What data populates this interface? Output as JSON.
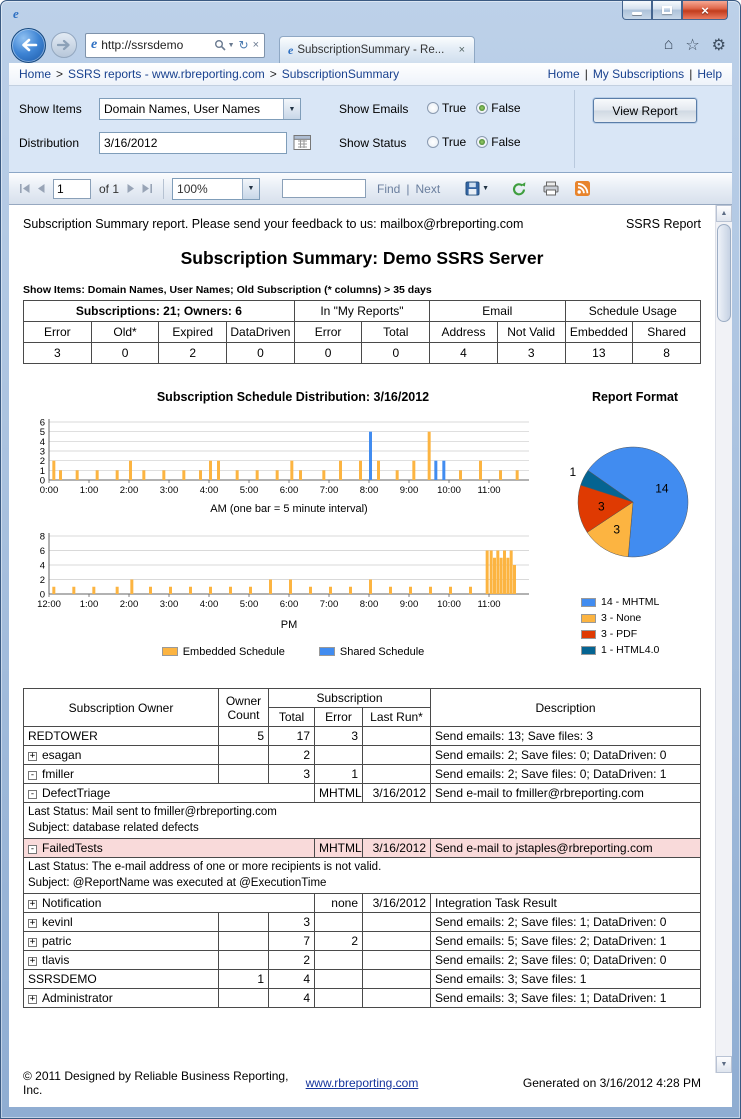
{
  "browser": {
    "url": "http://ssrsdemo",
    "tab_title": "SubscriptionSummary - Re...",
    "crumb_separator": ">",
    "link_separator": "|",
    "breadcrumbs": [
      "Home",
      "SSRS reports - www.rbreporting.com",
      "SubscriptionSummary"
    ],
    "top_links": [
      "Home",
      "My Subscriptions",
      "Help"
    ]
  },
  "icons": {
    "ie_logo": "e",
    "close": "×",
    "caret": "▼",
    "home": "⌂",
    "star": "☆",
    "gear": "⚙",
    "refresh": "↻",
    "up": "▲",
    "down": "▼",
    "pipe": "|"
  },
  "parameters": {
    "show_items_label": "Show Items",
    "show_items_value": "Domain Names, User Names",
    "show_emails_label": "Show Emails",
    "show_emails_value": "False",
    "distribution_label": "Distribution",
    "distribution_value": "3/16/2012",
    "show_status_label": "Show Status",
    "show_status_value": "False",
    "true_label": "True",
    "false_label": "False",
    "view_report_label": "View Report"
  },
  "viewer_toolbar": {
    "current_page": "1",
    "page_count_label": "of 1",
    "zoom_value": "100%",
    "find_value": "",
    "find_label": "Find",
    "next_label": "Next"
  },
  "report": {
    "feedback_line": "Subscription Summary report. Please send your feedback to us: mailbox@rbreporting.com",
    "corner_label": "SSRS Report",
    "title": "Subscription Summary: Demo SSRS Server",
    "filter_line": "Show Items: Domain Names, User Names; Old Subscription (* columns) > 35 days",
    "summary_table": {
      "groups": [
        {
          "label": "Subscriptions: 21; Owners: 6",
          "bold": true,
          "columns": [
            "Error",
            "Old*",
            "Expired",
            "DataDriven"
          ],
          "values": [
            "3",
            "0",
            "2",
            "0"
          ]
        },
        {
          "label": "In \"My Reports\"",
          "bold": false,
          "columns": [
            "Error",
            "Total"
          ],
          "values": [
            "0",
            "0"
          ]
        },
        {
          "label": "Email",
          "bold": false,
          "columns": [
            "Address",
            "Not Valid"
          ],
          "values": [
            "4",
            "3"
          ]
        },
        {
          "label": "Schedule Usage",
          "bold": false,
          "columns": [
            "Embedded",
            "Shared"
          ],
          "values": [
            "13",
            "8"
          ]
        }
      ]
    },
    "footer": {
      "copyright": "© 2011 Designed by Reliable Business Reporting, Inc.",
      "link": "www.rbreporting.com",
      "generated": "Generated on 3/16/2012 4:28 PM"
    }
  },
  "chart_data": [
    {
      "type": "bar",
      "title": "Subscription Schedule Distribution: 3/16/2012",
      "xlabel": "AM (one bar = 5 minute interval)",
      "ylim": [
        0,
        6
      ],
      "yticks": [
        0,
        1,
        2,
        3,
        4,
        5,
        6
      ],
      "xticks": [
        "0:00",
        "1:00",
        "2:00",
        "3:00",
        "4:00",
        "5:00",
        "6:00",
        "7:00",
        "8:00",
        "9:00",
        "10:00",
        "11:00"
      ],
      "x_total_minutes": 720,
      "colors": {
        "embedded": "#FCB441",
        "shared": "#418CF0"
      },
      "legend": [
        {
          "label": "Embedded Schedule",
          "color": "#FCB441"
        },
        {
          "label": "Shared Schedule",
          "color": "#418CF0"
        }
      ],
      "bars": [
        [
          5,
          2
        ],
        [
          15,
          1
        ],
        [
          40,
          1
        ],
        [
          70,
          1
        ],
        [
          100,
          1
        ],
        [
          120,
          2
        ],
        [
          140,
          1
        ],
        [
          170,
          1
        ],
        [
          200,
          1
        ],
        [
          225,
          1
        ],
        [
          240,
          2
        ],
        [
          252,
          2
        ],
        [
          280,
          1
        ],
        [
          310,
          1
        ],
        [
          340,
          1
        ],
        [
          362,
          2
        ],
        [
          375,
          1
        ],
        [
          410,
          1
        ],
        [
          435,
          2
        ],
        [
          465,
          2
        ],
        [
          480,
          5,
          "s"
        ],
        [
          492,
          2
        ],
        [
          520,
          1
        ],
        [
          545,
          2
        ],
        [
          568,
          5
        ],
        [
          578,
          2,
          "s"
        ],
        [
          590,
          2,
          "s"
        ],
        [
          615,
          1
        ],
        [
          645,
          2
        ],
        [
          675,
          1
        ],
        [
          700,
          1
        ]
      ]
    },
    {
      "type": "bar",
      "title": "",
      "xlabel": "PM",
      "ylim": [
        0,
        8
      ],
      "yticks": [
        0,
        2,
        4,
        6,
        8
      ],
      "xticks": [
        "12:00",
        "1:00",
        "2:00",
        "3:00",
        "4:00",
        "5:00",
        "6:00",
        "7:00",
        "8:00",
        "9:00",
        "10:00",
        "11:00"
      ],
      "x_total_minutes": 720,
      "colors": {
        "embedded": "#FCB441",
        "shared": "#418CF0"
      },
      "bars": [
        [
          5,
          1
        ],
        [
          35,
          1
        ],
        [
          65,
          1
        ],
        [
          100,
          1
        ],
        [
          122,
          2
        ],
        [
          150,
          1
        ],
        [
          180,
          1
        ],
        [
          210,
          1
        ],
        [
          240,
          1
        ],
        [
          270,
          1
        ],
        [
          300,
          1
        ],
        [
          330,
          2
        ],
        [
          360,
          2
        ],
        [
          390,
          1
        ],
        [
          420,
          1
        ],
        [
          450,
          1
        ],
        [
          480,
          2
        ],
        [
          510,
          1
        ],
        [
          540,
          1
        ],
        [
          570,
          1
        ],
        [
          600,
          1
        ],
        [
          630,
          1
        ],
        [
          655,
          6
        ],
        [
          661,
          6
        ],
        [
          666,
          5
        ],
        [
          671,
          6
        ],
        [
          676,
          5
        ],
        [
          681,
          6
        ],
        [
          686,
          5
        ],
        [
          691,
          6
        ],
        [
          696,
          4
        ]
      ]
    },
    {
      "type": "pie",
      "title": "Report Format",
      "start_angle": -55,
      "slices": [
        {
          "label": "14 - MHTML",
          "value": 14,
          "color": "#418CF0"
        },
        {
          "label": "3 - None",
          "value": 3,
          "color": "#FCB441"
        },
        {
          "label": "3 - PDF",
          "value": 3,
          "color": "#DF3A02"
        },
        {
          "label": "1 - HTML4.0",
          "value": 1,
          "color": "#056492"
        }
      ]
    }
  ],
  "detail_table": {
    "headers": {
      "owner": "Subscription Owner",
      "count": "Owner Count",
      "group": "Subscription",
      "total": "Total",
      "error": "Error",
      "last_run": "Last Run*",
      "desc": "Description"
    },
    "rows": [
      {
        "type": "owner",
        "name": "REDTOWER",
        "count": "5",
        "total": "17",
        "error": "3",
        "last_run": "",
        "desc": "Send emails: 13; Save files: 3"
      },
      {
        "type": "user",
        "state": "+",
        "name": "esagan",
        "total": "2",
        "error": "",
        "desc": "Send emails: 2; Save files: 0; DataDriven: 0"
      },
      {
        "type": "user",
        "state": "-",
        "name": "fmiller",
        "total": "3",
        "error": "1",
        "desc": "Send emails: 2; Save files: 0; DataDriven: 1"
      },
      {
        "type": "sub",
        "state": "-",
        "name": "DefectTriage",
        "format": "MHTML",
        "last_run": "3/16/2012",
        "desc": "Send e-mail to fmiller@rbreporting.com"
      },
      {
        "type": "status",
        "lines": [
          "Last Status: Mail sent to fmiller@rbreporting.com",
          "Subject: database related defects"
        ]
      },
      {
        "type": "sub",
        "state": "-",
        "name": "FailedTests",
        "format": "MHTML",
        "last_run": "3/16/2012",
        "desc": "Send e-mail to jstaples@rbreporting.com",
        "highlight": true
      },
      {
        "type": "status",
        "lines": [
          "Last Status: The e-mail address of one or more recipients is not valid.",
          "Subject: @ReportName was executed at @ExecutionTime"
        ]
      },
      {
        "type": "sub",
        "state": "+",
        "name": "Notification",
        "format": "none",
        "last_run": "3/16/2012",
        "desc": "Integration Task Result"
      },
      {
        "type": "user",
        "state": "+",
        "name": "kevinl",
        "total": "3",
        "error": "",
        "desc": "Send emails: 2; Save files: 1; DataDriven: 0"
      },
      {
        "type": "user",
        "state": "+",
        "name": "patric",
        "total": "7",
        "error": "2",
        "desc": "Send emails: 5; Save files: 2; DataDriven: 1"
      },
      {
        "type": "user",
        "state": "+",
        "name": "tlavis",
        "total": "2",
        "error": "",
        "desc": "Send emails: 2; Save files: 0; DataDriven: 0"
      },
      {
        "type": "owner",
        "name": "SSRSDEMO",
        "count": "1",
        "total": "4",
        "error": "",
        "last_run": "",
        "desc": "Send emails: 3; Save files: 1"
      },
      {
        "type": "user",
        "state": "+",
        "name": "Administrator",
        "total": "4",
        "error": "",
        "desc": "Send emails: 3; Save files: 1; DataDriven: 1"
      }
    ]
  }
}
